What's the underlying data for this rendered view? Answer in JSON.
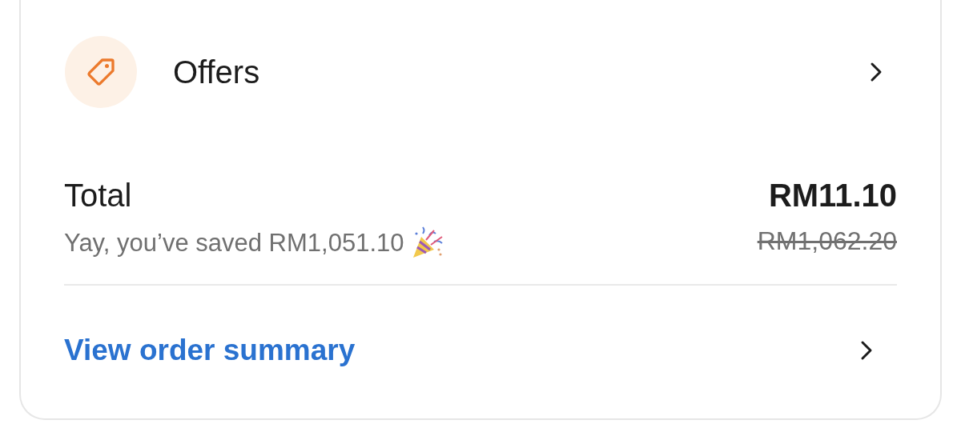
{
  "offers": {
    "label": "Offers"
  },
  "total": {
    "label": "Total",
    "savings": "Yay, you’ve saved RM1,051.10",
    "price": "RM11.10",
    "original_price": "RM1,062.20"
  },
  "order_summary": {
    "label": "View order summary"
  }
}
